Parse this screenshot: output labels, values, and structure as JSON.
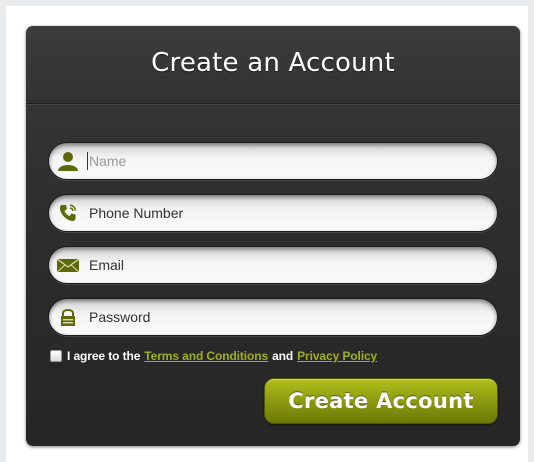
{
  "form": {
    "title": "Create an Account",
    "fields": [
      {
        "name": "name",
        "placeholder": "Name",
        "value": "",
        "icon": "user-icon"
      },
      {
        "name": "phone",
        "placeholder": "Phone Number",
        "value": "",
        "icon": "phone-icon"
      },
      {
        "name": "email",
        "placeholder": "Email",
        "value": "",
        "icon": "envelope-icon"
      },
      {
        "name": "password",
        "placeholder": "Password",
        "value": "",
        "icon": "lock-icon"
      }
    ],
    "agree": {
      "prefix": "I agree to the",
      "terms_link": "Terms and Conditions",
      "conjunction": "and",
      "privacy_link": "Privacy Policy",
      "checked": false
    },
    "submit_label": "Create Account"
  },
  "colors": {
    "accent": "#8b9a10",
    "link": "#9eaf1e",
    "icon": "#5e6a0a",
    "card": "#2e2e2e"
  }
}
